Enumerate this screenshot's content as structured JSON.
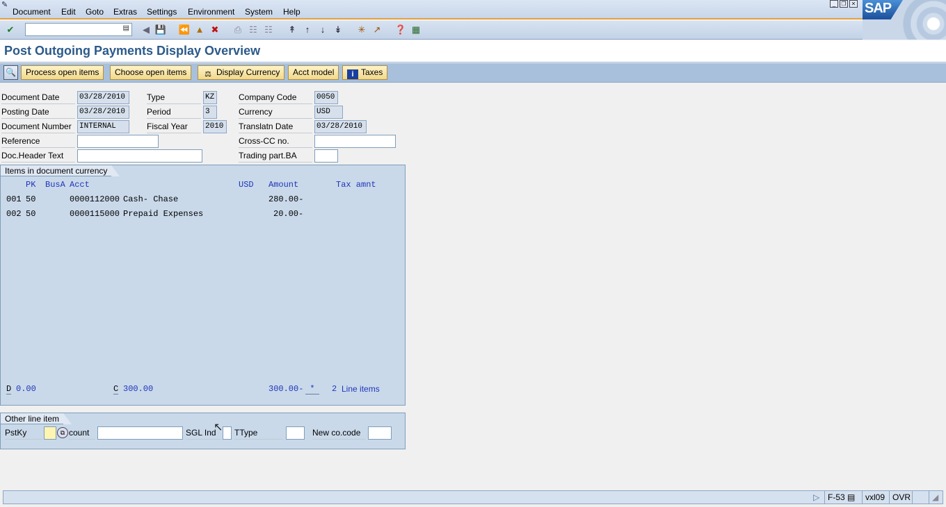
{
  "menu": {
    "items": [
      "Document",
      "Edit",
      "Goto",
      "Extras",
      "Settings",
      "Environment",
      "System",
      "Help"
    ],
    "logo": "SAP"
  },
  "toolbar": {
    "command_value": ""
  },
  "title": "Post Outgoing Payments Display Overview",
  "app_toolbar": {
    "process_open_items": "Process open items",
    "choose_open_items": "Choose open items",
    "display_currency": "Display Currency",
    "acct_model": "Acct model",
    "taxes": "Taxes"
  },
  "header": {
    "document_date_label": "Document Date",
    "document_date": "03/28/2010",
    "posting_date_label": "Posting Date",
    "posting_date": "03/28/2010",
    "document_number_label": "Document Number",
    "document_number": "INTERNAL",
    "reference_label": "Reference",
    "reference": "",
    "doc_header_text_label": "Doc.Header Text",
    "doc_header_text": "",
    "type_label": "Type",
    "type": "KZ",
    "period_label": "Period",
    "period": "3",
    "fiscal_year_label": "Fiscal Year",
    "fiscal_year": "2010",
    "company_code_label": "Company Code",
    "company_code": "0050",
    "currency_label": "Currency",
    "currency": "USD",
    "translation_date_label": "Translatn Date",
    "translation_date": "03/28/2010",
    "cross_cc_label": "Cross-CC no.",
    "cross_cc": "",
    "trading_part_label": "Trading part.BA",
    "trading_part": ""
  },
  "items": {
    "group_title": "Items in document currency",
    "col_pk": "PK",
    "col_busa": "BusA",
    "col_acct": "Acct",
    "col_currency": "USD",
    "col_amount": "Amount",
    "col_tax": "Tax amnt",
    "rows": [
      {
        "no": "001",
        "pk": "50",
        "acct": "0000112000",
        "desc": "Cash- Chase",
        "amount": "280.00-"
      },
      {
        "no": "002",
        "pk": "50",
        "acct": "0000115000",
        "desc": "Prepaid Expenses",
        "amount": "20.00-"
      }
    ],
    "debit_label": "D",
    "debit_total": "0.00",
    "credit_label": "C",
    "credit_total": "300.00",
    "balance": "300.00-",
    "balance_flag": "*",
    "line_count": "2",
    "line_items_label": "Line items"
  },
  "other_line_item": {
    "group_title": "Other line item",
    "pstky_label": "PstKy",
    "pstky": "",
    "account_label": "count",
    "account": "",
    "sgl_ind_label": "SGL Ind",
    "sgl_ind": "",
    "ttype_label": "TType",
    "ttype": "",
    "new_co_code_label": "New co.code",
    "new_co_code": ""
  },
  "status_bar": {
    "transaction": "F-53",
    "server": "vxl09",
    "mode": "OVR"
  }
}
